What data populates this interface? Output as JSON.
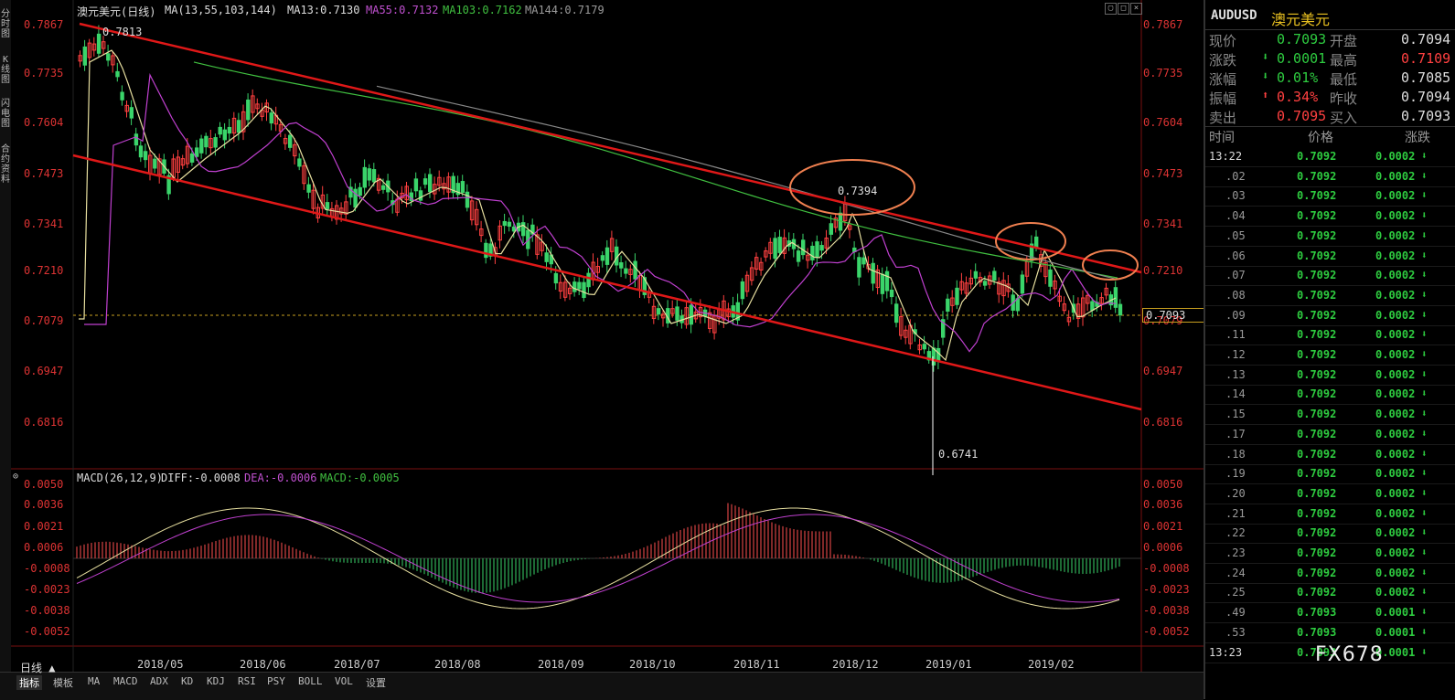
{
  "header": {
    "title": "澳元美元(日线)",
    "ma_label": "MA(13,55,103,144)",
    "ma13": "MA13:0.7130",
    "ma55": "MA55:0.7132",
    "ma103": "MA103:0.7162",
    "ma144": "MA144:0.7179"
  },
  "left_tabs": [
    "分时图",
    "K线图",
    "闪电图",
    "合约资料"
  ],
  "price_axis": [
    "0.7867",
    "0.7735",
    "0.7604",
    "0.7473",
    "0.7341",
    "0.7210",
    "0.7079",
    "0.6947",
    "0.6816"
  ],
  "current_price_tag": "0.7093",
  "annotations": {
    "high": "0.7813",
    "peak": "0.7394",
    "low": "0.6741"
  },
  "macd": {
    "label": "MACD(26,12,9)",
    "diff": "DIFF:-0.0008",
    "dea": "DEA:-0.0006",
    "macd": "MACD:-0.0005",
    "axis": [
      "0.0050",
      "0.0036",
      "0.0021",
      "0.0006",
      "-0.0008",
      "-0.0023",
      "-0.0038",
      "-0.0052"
    ]
  },
  "months": [
    "2018/05",
    "2018/06",
    "2018/07",
    "2018/08",
    "2018/09",
    "2018/10",
    "2018/11",
    "2018/12",
    "2019/01",
    "2019/02"
  ],
  "bottom": {
    "period": "日线 ▲",
    "tabs": [
      "指标",
      "模板",
      "MA",
      "MACD",
      "ADX",
      "KD",
      "KDJ",
      "RSI",
      "PSY",
      "BOLL",
      "VOL",
      "设置"
    ]
  },
  "quote": {
    "symbol": "AUDUSD",
    "name": "澳元美元",
    "rows": [
      {
        "l1": "现价",
        "v1": "0.7093",
        "l2": "开盘",
        "v2": "0.7094"
      },
      {
        "l1": "涨跌",
        "v1": "0.0001",
        "l2": "最高",
        "v2": "0.7109"
      },
      {
        "l1": "涨幅",
        "v1": "0.01%",
        "l2": "最低",
        "v2": "0.7085"
      },
      {
        "l1": "振幅",
        "v1": "0.34%",
        "l2": "昨收",
        "v2": "0.7094"
      },
      {
        "l1": "卖出",
        "v1": "0.7095",
        "l2": "买入",
        "v2": "0.7093"
      }
    ]
  },
  "ticks": {
    "headers": [
      "时间",
      "价格",
      "涨跌"
    ],
    "rows": [
      {
        "t": "13:22",
        "p": "0.7092",
        "c": "0.0002"
      },
      {
        "t": ".02",
        "p": "0.7092",
        "c": "0.0002"
      },
      {
        "t": ".03",
        "p": "0.7092",
        "c": "0.0002"
      },
      {
        "t": ".04",
        "p": "0.7092",
        "c": "0.0002"
      },
      {
        "t": ".05",
        "p": "0.7092",
        "c": "0.0002"
      },
      {
        "t": ".06",
        "p": "0.7092",
        "c": "0.0002"
      },
      {
        "t": ".07",
        "p": "0.7092",
        "c": "0.0002"
      },
      {
        "t": ".08",
        "p": "0.7092",
        "c": "0.0002"
      },
      {
        "t": ".09",
        "p": "0.7092",
        "c": "0.0002"
      },
      {
        "t": ".11",
        "p": "0.7092",
        "c": "0.0002"
      },
      {
        "t": ".12",
        "p": "0.7092",
        "c": "0.0002"
      },
      {
        "t": ".13",
        "p": "0.7092",
        "c": "0.0002"
      },
      {
        "t": ".14",
        "p": "0.7092",
        "c": "0.0002"
      },
      {
        "t": ".15",
        "p": "0.7092",
        "c": "0.0002"
      },
      {
        "t": ".17",
        "p": "0.7092",
        "c": "0.0002"
      },
      {
        "t": ".18",
        "p": "0.7092",
        "c": "0.0002"
      },
      {
        "t": ".19",
        "p": "0.7092",
        "c": "0.0002"
      },
      {
        "t": ".20",
        "p": "0.7092",
        "c": "0.0002"
      },
      {
        "t": ".21",
        "p": "0.7092",
        "c": "0.0002"
      },
      {
        "t": ".22",
        "p": "0.7092",
        "c": "0.0002"
      },
      {
        "t": ".23",
        "p": "0.7092",
        "c": "0.0002"
      },
      {
        "t": ".24",
        "p": "0.7092",
        "c": "0.0002"
      },
      {
        "t": ".25",
        "p": "0.7092",
        "c": "0.0002"
      },
      {
        "t": ".49",
        "p": "0.7093",
        "c": "0.0001"
      },
      {
        "t": ".53",
        "p": "0.7093",
        "c": "0.0001"
      },
      {
        "t": "13:23",
        "p": "0.7093",
        "c": "0.0001"
      }
    ]
  },
  "watermark": "FX678"
}
